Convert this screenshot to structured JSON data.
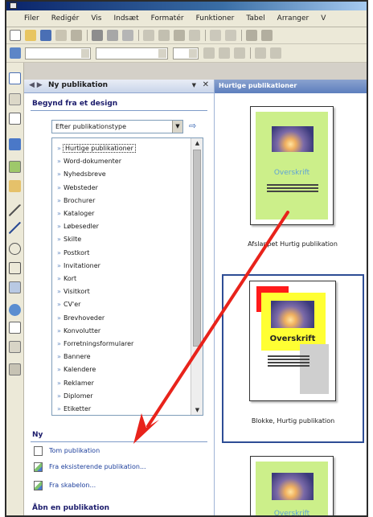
{
  "menubar": {
    "items": [
      "Filer",
      "Redigér",
      "Vis",
      "Indsæt",
      "Formatér",
      "Funktioner",
      "Tabel",
      "Arranger",
      "V"
    ]
  },
  "task_pane": {
    "title": "Ny publikation",
    "section_design_title": "Begynd fra et design",
    "dropdown_value": "Efter publikationstype",
    "publication_types": [
      "Hurtige publikationer",
      "Word-dokumenter",
      "Nyhedsbreve",
      "Websteder",
      "Brochurer",
      "Kataloger",
      "Løbesedler",
      "Skilte",
      "Postkort",
      "Invitationer",
      "Kort",
      "Visitkort",
      "CV'er",
      "Brevhoveder",
      "Konvolutter",
      "Forretningsformularer",
      "Bannere",
      "Kalendere",
      "Reklamer",
      "Diplomer",
      "Etiketter"
    ],
    "section_new_title": "Ny",
    "new_links": [
      "Tom publikation",
      "Fra eksisterende publikation...",
      "Fra skabelon..."
    ],
    "section_open_title": "Åbn en publikation"
  },
  "gallery": {
    "header": "Hurtige publikationer",
    "tiles": [
      {
        "caption": "Afslappet Hurtig publikation",
        "headline": "Overskrift",
        "bg": "#ccef8a"
      },
      {
        "caption": "Blokke, Hurtig publikation",
        "headline": "Overskrift",
        "bg": "#ffff33"
      },
      {
        "caption": "",
        "headline": "Overskrift",
        "bg": "#ccef8a"
      }
    ]
  },
  "colors": {
    "arrow": "#e8231b",
    "taskpane_border": "#7f9bc8",
    "selection": "#2e4d95"
  },
  "icons": [
    "new-icon",
    "open-icon",
    "save-icon",
    "print-icon",
    "preview-icon",
    "cut-icon",
    "copy-icon",
    "paste-icon",
    "undo-icon",
    "redo-icon",
    "pointer-icon",
    "text-box-icon",
    "table-icon",
    "wordart-icon",
    "picture-icon",
    "line-icon",
    "arrow-icon",
    "oval-icon",
    "rectangle-icon",
    "shapes-icon",
    "design-gallery-icon",
    "hotspot-icon",
    "dropdown-arrow-icon",
    "scroll-up-icon",
    "scroll-down-icon",
    "close-icon",
    "back-forward-icon"
  ]
}
